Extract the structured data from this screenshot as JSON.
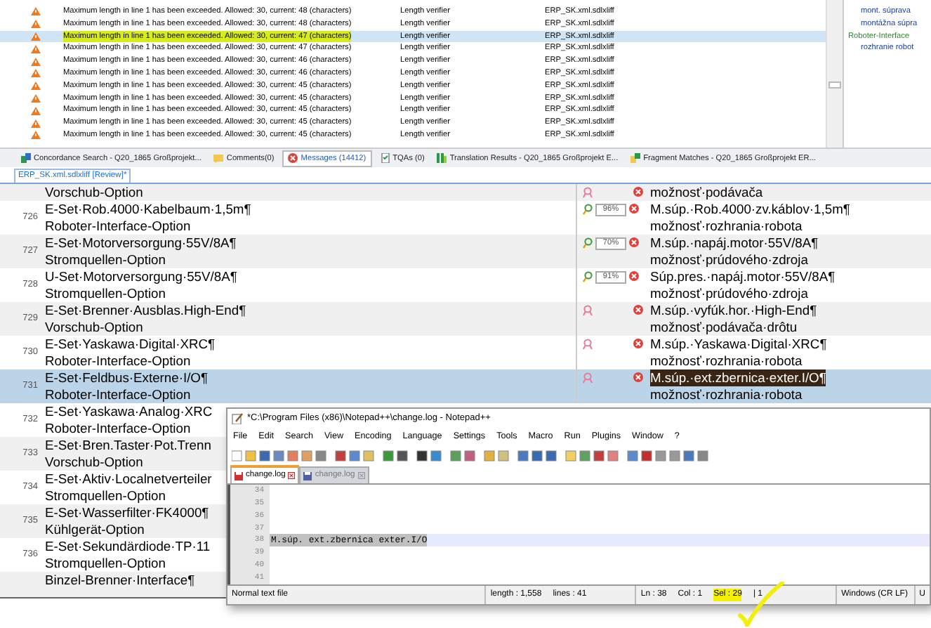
{
  "messages": {
    "rows": [
      {
        "text": "Maximum length in line 1 has been exceeded. Allowed: 30, current: 48 (characters)",
        "origin": "Length verifier",
        "file": "ERP_SK.xml.sdlxliff",
        "selected": false,
        "highlighted": false
      },
      {
        "text": "Maximum length in line 1 has been exceeded. Allowed: 30, current: 48 (characters)",
        "origin": "Length verifier",
        "file": "ERP_SK.xml.sdlxliff",
        "selected": false,
        "highlighted": false
      },
      {
        "text": "Maximum length in line 1 has been exceeded. Allowed: 30, current: 47 (characters)",
        "origin": "Length verifier",
        "file": "ERP_SK.xml.sdlxliff",
        "selected": true,
        "highlighted": true
      },
      {
        "text": "Maximum length in line 1 has been exceeded. Allowed: 30, current: 47 (characters)",
        "origin": "Length verifier",
        "file": "ERP_SK.xml.sdlxliff",
        "selected": false,
        "highlighted": false
      },
      {
        "text": "Maximum length in line 1 has been exceeded. Allowed: 30, current: 46 (characters)",
        "origin": "Length verifier",
        "file": "ERP_SK.xml.sdlxliff",
        "selected": false,
        "highlighted": false
      },
      {
        "text": "Maximum length in line 1 has been exceeded. Allowed: 30, current: 46 (characters)",
        "origin": "Length verifier",
        "file": "ERP_SK.xml.sdlxliff",
        "selected": false,
        "highlighted": false
      },
      {
        "text": "Maximum length in line 1 has been exceeded. Allowed: 30, current: 45 (characters)",
        "origin": "Length verifier",
        "file": "ERP_SK.xml.sdlxliff",
        "selected": false,
        "highlighted": false
      },
      {
        "text": "Maximum length in line 1 has been exceeded. Allowed: 30, current: 45 (characters)",
        "origin": "Length verifier",
        "file": "ERP_SK.xml.sdlxliff",
        "selected": false,
        "highlighted": false
      },
      {
        "text": "Maximum length in line 1 has been exceeded. Allowed: 30, current: 45 (characters)",
        "origin": "Length verifier",
        "file": "ERP_SK.xml.sdlxliff",
        "selected": false,
        "highlighted": false
      },
      {
        "text": "Maximum length in line 1 has been exceeded. Allowed: 30, current: 45 (characters)",
        "origin": "Length verifier",
        "file": "ERP_SK.xml.sdlxliff",
        "selected": false,
        "highlighted": false
      },
      {
        "text": "Maximum length in line 1 has been exceeded. Allowed: 30, current: 45 (characters)",
        "origin": "Length verifier",
        "file": "ERP_SK.xml.sdlxliff",
        "selected": false,
        "highlighted": false
      }
    ]
  },
  "preview_panel": {
    "lines": [
      {
        "text": "mont. súprava",
        "kind": "target"
      },
      {
        "text": "montážna súpra",
        "kind": "target"
      },
      {
        "text": "Roboter-Interface",
        "kind": "source"
      },
      {
        "text": "rozhranie robot",
        "kind": "target"
      }
    ]
  },
  "panel_tabs": [
    {
      "label": "Concordance Search - Q20_1865 Großprojekt...",
      "kind": "concordance",
      "selected": false
    },
    {
      "label": "Comments(0)",
      "kind": "comments",
      "selected": false
    },
    {
      "label": "Messages (14412)",
      "kind": "messages",
      "selected": true
    },
    {
      "label": "TQAs (0)",
      "kind": "tqa",
      "selected": false
    },
    {
      "label": "Translation Results - Q20_1865 Großprojekt E...",
      "kind": "results",
      "selected": false
    },
    {
      "label": "Fragment Matches - Q20_1865 Großprojekt ER...",
      "kind": "fragments",
      "selected": false
    }
  ],
  "document_tab": {
    "label": "ERP_SK.xml.sdlxliff [Review]*"
  },
  "segments": [
    {
      "source": [
        "Vorschub-Option"
      ],
      "target": [
        "možnosť·podávača"
      ],
      "kind": "none",
      "selected": false,
      "target_selected": false
    },
    {
      "number": "726",
      "source": [
        "E-Set·Rob.4000·Kabelbaum·1,5m¶",
        "Roboter-Interface-Option"
      ],
      "target": [
        "M.súp.·Rob.4000·zv.káblov·1,5m¶",
        "možnosť·rozhrania·robota"
      ],
      "kind": "fuzzy",
      "match": "96%",
      "selected": false,
      "target_selected": false
    },
    {
      "number": "727",
      "source": [
        "E-Set·Motorversorgung·55V/8A¶",
        "Stromquellen-Option"
      ],
      "target": [
        "M.súp.·napáj.motor·55V/8A¶",
        "možnosť·prúdového·zdroja"
      ],
      "kind": "fuzzy",
      "match": "70%",
      "selected": false,
      "target_selected": false
    },
    {
      "number": "728",
      "source": [
        "U-Set·Motorversorgung·55V/8A¶",
        "Stromquellen-Option"
      ],
      "target": [
        "Súp.pres.·napáj.motor·55V/8A¶",
        "možnosť·prúdového·zdroja"
      ],
      "kind": "fuzzy",
      "match": "91%",
      "selected": false,
      "target_selected": false
    },
    {
      "number": "729",
      "source": [
        "E-Set·Brenner·Ausblas.High-End¶",
        "Vorschub-Option"
      ],
      "target": [
        "M.súp.·vyfúk.hor.·High-End¶",
        "možnosť·podávača·drôtu"
      ],
      "kind": "none",
      "selected": false,
      "target_selected": false
    },
    {
      "number": "730",
      "source": [
        "E-Set·Yaskawa·Digital·XRC¶",
        "Roboter-Interface-Option"
      ],
      "target": [
        "M.súp.·Yaskawa·Digital·XRC¶",
        "možnosť·rozhrania·robota"
      ],
      "kind": "none",
      "selected": false,
      "target_selected": false
    },
    {
      "number": "731",
      "source": [
        "E-Set·Feldbus·Externe·I/O¶",
        "Roboter-Interface-Option"
      ],
      "target": [
        "M.súp.·ext.zbernica·exter.I/O¶",
        "možnosť·rozhrania·robota"
      ],
      "kind": "none",
      "selected": true,
      "target_selected": true
    },
    {
      "number": "732",
      "source": [
        "E-Set·Yaskawa·Analog·XRC",
        "Roboter-Interface-Option"
      ],
      "selected": false
    },
    {
      "number": "733",
      "source": [
        "E-Set·Bren.Taster·Pot.Trenn",
        "Vorschub-Option"
      ],
      "selected": false
    },
    {
      "number": "734",
      "source": [
        "E-Set·Aktiv·Localnetverteiler",
        "Stromquellen-Option"
      ],
      "selected": false
    },
    {
      "number": "735",
      "source": [
        "E-Set·Wasserfilter·FK4000¶",
        "Kühlgerät-Option"
      ],
      "selected": false
    },
    {
      "number": "736",
      "source": [
        "E-Set·Sekundärdiode·TP·11",
        "Stromquellen-Option"
      ],
      "selected": false
    },
    {
      "source": [
        "Binzel-Brenner·Interface¶"
      ],
      "selected": false
    }
  ],
  "notepad": {
    "title": "*C:\\Program Files (x86)\\Notepad++\\change.log - Notepad++",
    "menu": [
      "File",
      "Edit",
      "Search",
      "View",
      "Encoding",
      "Language",
      "Settings",
      "Tools",
      "Macro",
      "Run",
      "Plugins",
      "Window",
      "?"
    ],
    "tabs": [
      {
        "label": "change.log",
        "selected": true
      },
      {
        "label": "change.log",
        "selected": false
      }
    ],
    "lines": [
      {
        "number": "34",
        "current": false
      },
      {
        "number": "35",
        "current": false
      },
      {
        "number": "36",
        "current": false
      },
      {
        "number": "37",
        "current": false
      },
      {
        "number": "38",
        "text": "M.súp. ext.zbernica exter.I/O",
        "current": true
      },
      {
        "number": "39",
        "current": false
      },
      {
        "number": "40",
        "current": false
      },
      {
        "number": "41",
        "current": false
      }
    ],
    "status": {
      "file_type": "Normal text file",
      "length": "length : 1,558",
      "lines": "lines : 41",
      "ln": "Ln : 38",
      "col": "Col : 1",
      "sel": {
        "text": "Sel : 29",
        "highlighted": true
      },
      "sel_lines": "| 1",
      "eol": "Windows (CR LF)",
      "encoding": "U"
    }
  }
}
